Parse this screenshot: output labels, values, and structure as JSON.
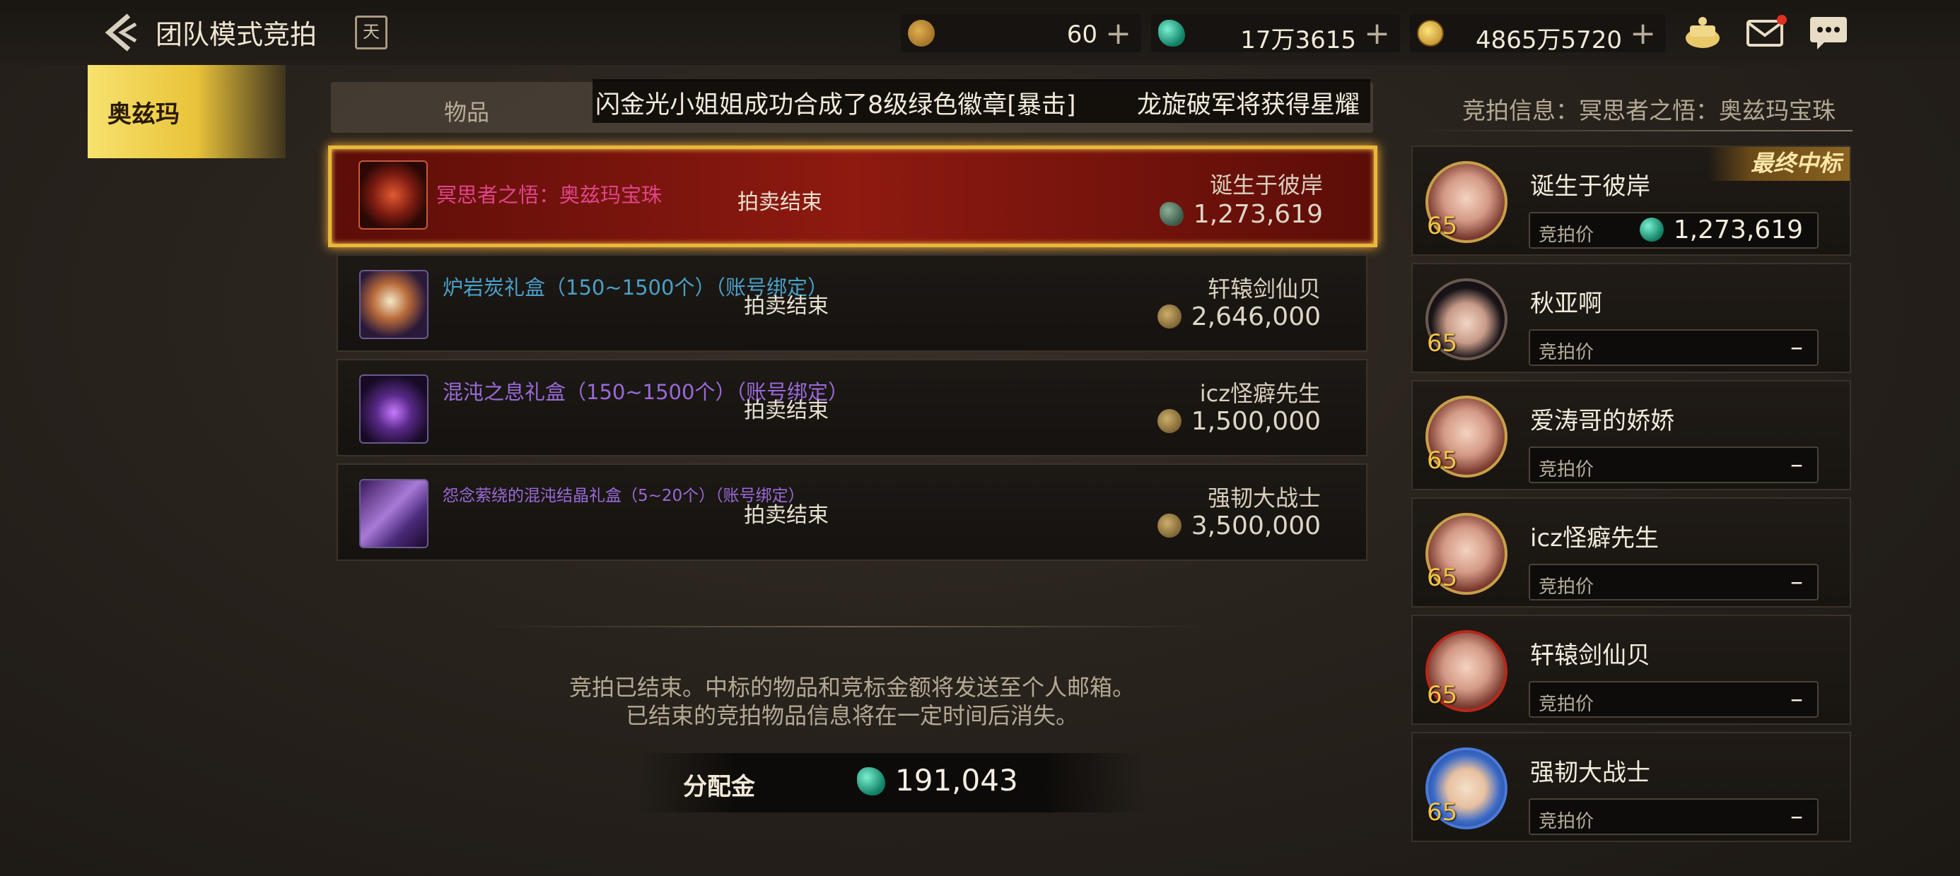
{
  "header": {
    "title": "团队模式竞拍",
    "calendar_label": "天",
    "currencies": [
      {
        "icon": "moon-token-icon",
        "value": "60"
      },
      {
        "icon": "gem-icon",
        "value": "17万3615"
      },
      {
        "icon": "gold-coin-icon",
        "value": "4865万5720"
      }
    ]
  },
  "sidebar": {
    "tab": "奥兹玛"
  },
  "list": {
    "col_item": "物品",
    "ticker": [
      "闪金光小姐姐成功合成了8级绿色徽章[暴击]",
      "龙旋破军将获得星耀"
    ],
    "rows": [
      {
        "name": "冥思者之悟：奥兹玛宝珠",
        "name_color": "#e0458a",
        "status": "拍卖结束",
        "bidder": "诞生于彼岸",
        "amount": "1,273,619",
        "winner": true
      },
      {
        "name": "炉岩炭礼盒（150~1500个）（账号绑定）",
        "name_color": "#4aa0c8",
        "status": "拍卖结束",
        "bidder": "轩辕剑仙贝",
        "amount": "2,646,000"
      },
      {
        "name": "混沌之息礼盒（150~1500个）（账号绑定）",
        "name_color": "#9a6ad8",
        "status": "拍卖结束",
        "bidder": "icz怪癖先生",
        "amount": "1,500,000"
      },
      {
        "name": "怨念萦绕的混沌结晶礼盒（5~20个）（账号绑定）",
        "name_color": "#9a6ad8",
        "status": "拍卖结束",
        "bidder": "强韧大战士",
        "amount": "3,500,000"
      }
    ]
  },
  "notice": {
    "line1": "竞拍已结束。中标的物品和竞标金额将发送至个人邮箱。",
    "line2": "已结束的竞拍物品信息将在一定时间后消失。"
  },
  "payout": {
    "label": "分配金",
    "value": "191,043"
  },
  "panel": {
    "info": "竞拍信息：冥思者之悟：奥兹玛宝珠",
    "final_tag": "最终中标",
    "bid_label": "竞拍价",
    "players": [
      {
        "name": "诞生于彼岸",
        "level": "65",
        "bid": "1,273,619"
      },
      {
        "name": "秋亚啊",
        "level": "65",
        "bid": "–"
      },
      {
        "name": "爱涛哥的娇娇",
        "level": "65",
        "bid": "–"
      },
      {
        "name": "icz怪癖先生",
        "level": "65",
        "bid": "–"
      },
      {
        "name": "轩辕剑仙贝",
        "level": "65",
        "bid": "–"
      },
      {
        "name": "强韧大战士",
        "level": "65",
        "bid": "–"
      }
    ]
  }
}
